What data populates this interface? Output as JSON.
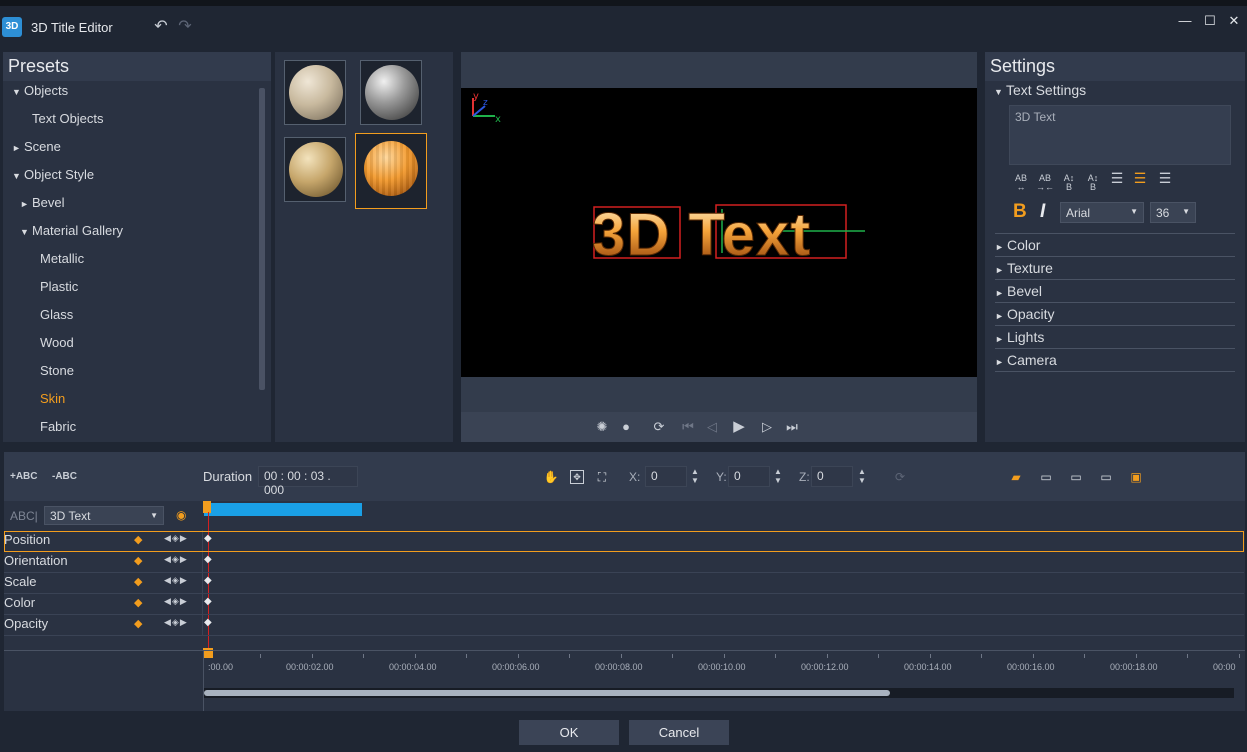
{
  "window": {
    "title": "3D Title Editor",
    "app_icon": "3D",
    "undo_icon": "undo-icon",
    "redo_icon": "redo-icon"
  },
  "presets": {
    "header": "Presets",
    "items": [
      {
        "label": "Objects",
        "expander": "▼"
      },
      {
        "label": "Text Objects",
        "expander": ""
      },
      {
        "label": "Scene",
        "expander": "►"
      },
      {
        "label": "Object Style",
        "expander": "▼"
      },
      {
        "label": "Bevel",
        "expander": "►"
      },
      {
        "label": "Material Gallery",
        "expander": "▼"
      },
      {
        "label": "Metallic",
        "expander": ""
      },
      {
        "label": "Plastic",
        "expander": ""
      },
      {
        "label": "Glass",
        "expander": ""
      },
      {
        "label": "Wood",
        "expander": ""
      },
      {
        "label": "Stone",
        "expander": ""
      },
      {
        "label": "Skin",
        "expander": ""
      },
      {
        "label": "Fabric",
        "expander": ""
      }
    ],
    "selected_item": "Skin",
    "accent_color": "#f29d1e"
  },
  "materials": {
    "thumbnails": [
      {
        "name": "skin-material-1",
        "selected": false
      },
      {
        "name": "skin-material-2",
        "selected": false
      },
      {
        "name": "skin-material-3",
        "selected": false
      },
      {
        "name": "skin-material-4",
        "selected": true
      }
    ]
  },
  "preview": {
    "text": "3D Text",
    "axes": {
      "x": "x",
      "y": "y",
      "z": "z"
    }
  },
  "settings": {
    "header": "Settings",
    "text_settings_label": "Text Settings",
    "text_value": "3D Text",
    "format_buttons": [
      "AB/AB",
      "AB/AB",
      "A/B",
      "A/B",
      "align-left",
      "align-center",
      "align-right"
    ],
    "bold": "B",
    "italic": "I",
    "font": "Arial",
    "size": "36",
    "sections": [
      "Color",
      "Texture",
      "Bevel",
      "Opacity",
      "Lights",
      "Camera"
    ]
  },
  "timeline": {
    "add_abc": "+ABC",
    "remove_abc": "-ABC",
    "duration_label": "Duration",
    "duration_value": "00 : 00 : 03 . 000",
    "x_label": "X:",
    "x_value": "0",
    "y_label": "Y:",
    "y_value": "0",
    "z_label": "Z:",
    "z_value": "0",
    "object_prefix": "ABC|",
    "object_select": "3D Text",
    "tracks": [
      "Position",
      "Orientation",
      "Scale",
      "Color",
      "Opacity"
    ],
    "ruler": [
      ":00.00",
      "00:00:02.00",
      "00:00:04.00",
      "00:00:06.00",
      "00:00:08.00",
      "00:00:10.00",
      "00:00:12.00",
      "00:00:14.00",
      "00:00:16.00",
      "00:00:18.00",
      "00:00"
    ]
  },
  "footer": {
    "ok": "OK",
    "cancel": "Cancel"
  }
}
